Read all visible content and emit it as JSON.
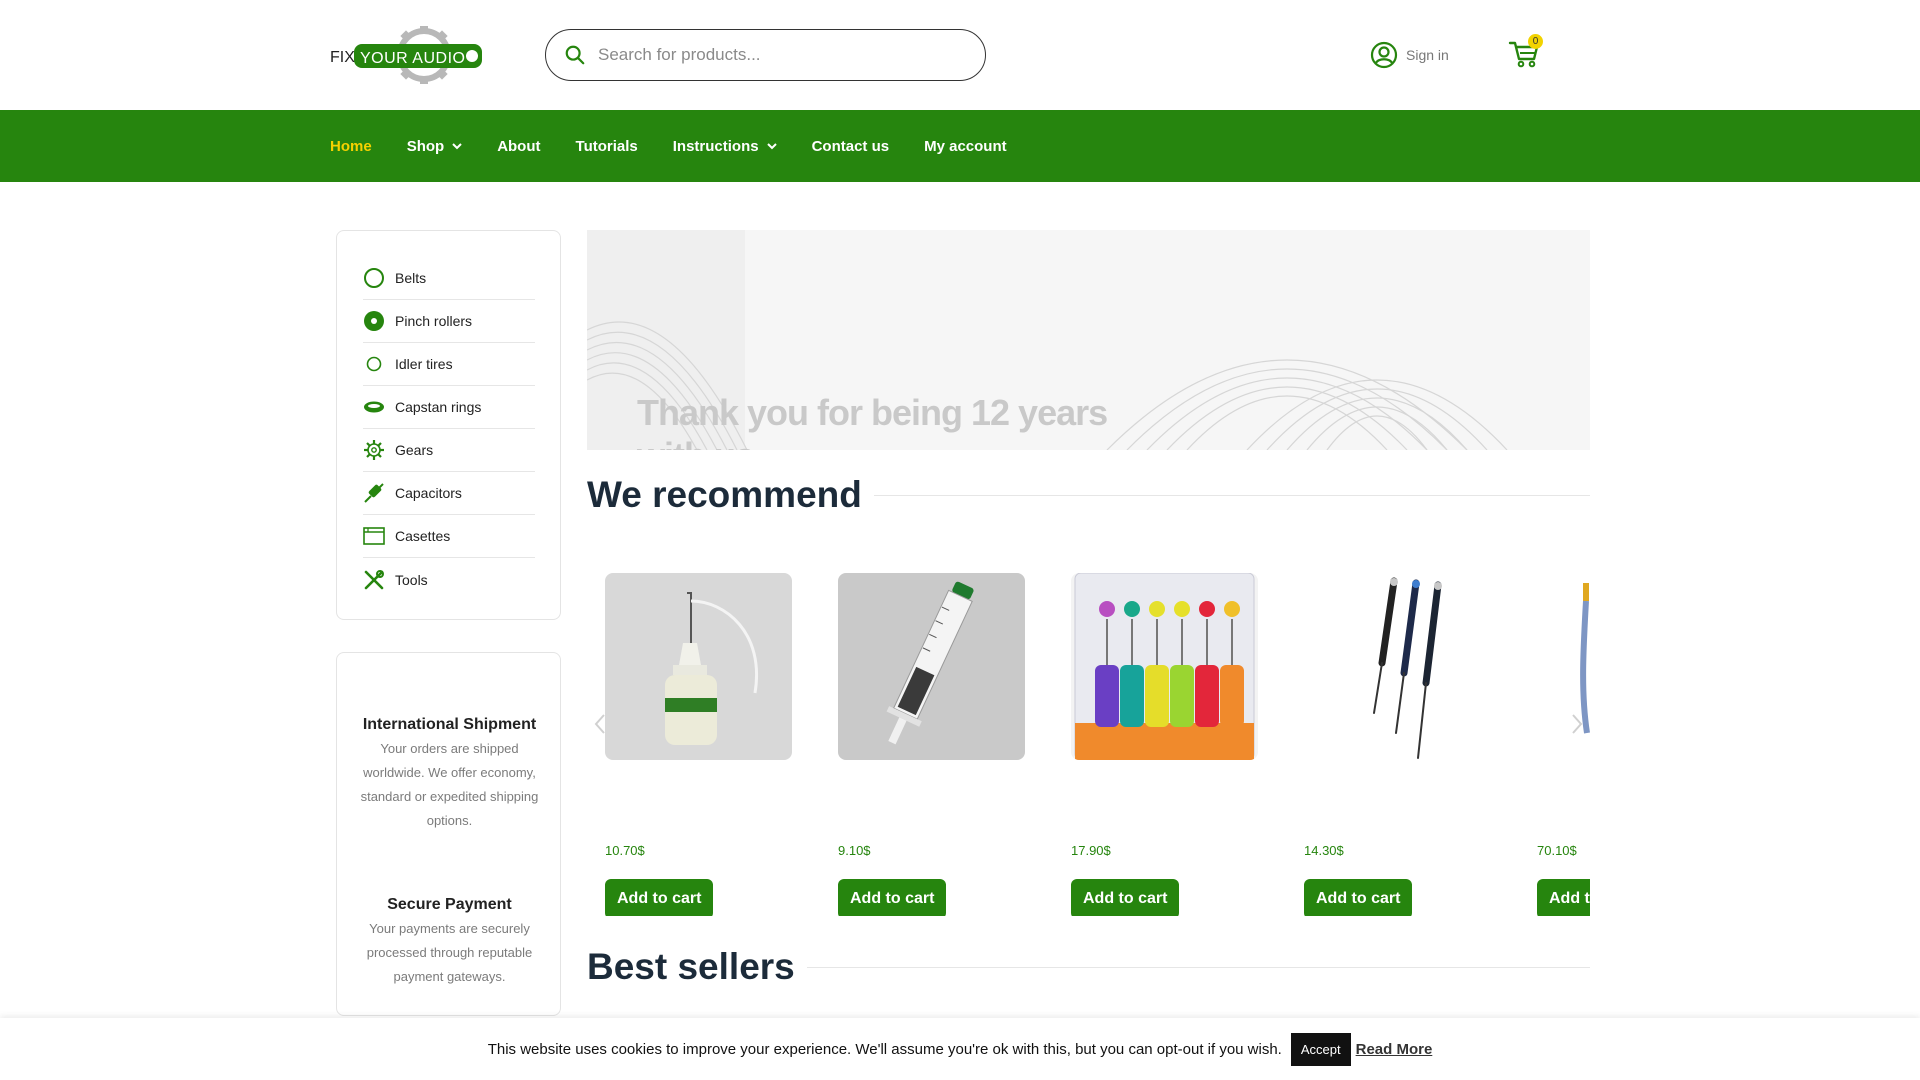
{
  "header": {
    "logo_text_left": "FIX",
    "logo_text_right": "YOUR AUDIO",
    "search_placeholder": "Search for products...",
    "signin_label": "Sign in",
    "cart_count": "0"
  },
  "nav": {
    "items": [
      {
        "label": "Home",
        "active": true
      },
      {
        "label": "Shop",
        "dropdown": true
      },
      {
        "label": "About"
      },
      {
        "label": "Tutorials"
      },
      {
        "label": "Instructions",
        "dropdown": true
      },
      {
        "label": "Contact us"
      },
      {
        "label": "My account"
      }
    ]
  },
  "sidebar": {
    "categories": [
      {
        "label": "Belts",
        "icon": "belt-icon"
      },
      {
        "label": "Pinch rollers",
        "icon": "pinch-roller-icon"
      },
      {
        "label": "Idler tires",
        "icon": "idler-tire-icon"
      },
      {
        "label": "Capstan rings",
        "icon": "capstan-ring-icon"
      },
      {
        "label": "Gears",
        "icon": "gear-icon"
      },
      {
        "label": "Capacitors",
        "icon": "capacitor-icon"
      },
      {
        "label": "Casettes",
        "icon": "cassette-icon"
      },
      {
        "label": "Tools",
        "icon": "tools-icon"
      }
    ],
    "info": [
      {
        "title": "International Shipment",
        "text": "Your orders are shipped worldwide. We offer economy, standard or expedited shipping options."
      },
      {
        "title": "Secure Payment",
        "text": "Your payments are securely processed through reputable payment gateways."
      }
    ]
  },
  "banner": {
    "line1": "Thank you for being 12 years",
    "line2": "with us"
  },
  "sections": {
    "recommend_title": "We recommend",
    "bestsellers_title": "Best sellers"
  },
  "products": [
    {
      "price": "10.70$",
      "button": "Add to cart",
      "image": "oil-bottle"
    },
    {
      "price": "9.10$",
      "button": "Add to cart",
      "image": "syringe"
    },
    {
      "price": "17.90$",
      "button": "Add to cart",
      "image": "screwdriver-set"
    },
    {
      "price": "14.30$",
      "button": "Add to cart",
      "image": "precision-screwdrivers"
    },
    {
      "price": "70.10$",
      "button": "Add to cart",
      "image": "tool"
    }
  ],
  "cookie": {
    "message": "This website uses cookies to improve your experience. We'll assume you're ok with this, but you can opt-out if you wish.",
    "accept_label": "Accept",
    "read_more_label": "Read More"
  },
  "colors": {
    "brand_green": "#26850e",
    "nav_active": "#f5d100",
    "title_dark": "#1c2b3a"
  }
}
